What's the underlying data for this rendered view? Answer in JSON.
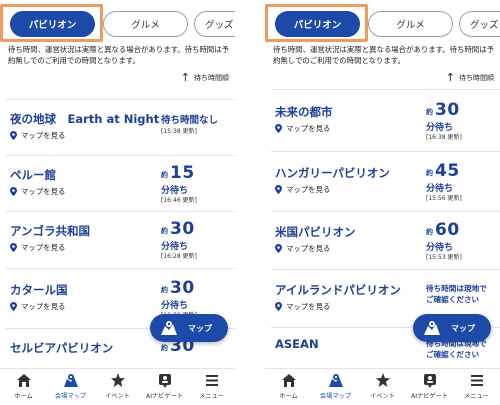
{
  "colors": {
    "primary": "#1d4aa8",
    "highlight": "#ef9a5f",
    "text": "#1d3f99"
  },
  "panels": [
    {
      "tabs": [
        {
          "label": "パビリオン",
          "active": true
        },
        {
          "label": "グルメ",
          "active": false
        },
        {
          "label": "グッズ",
          "active": false
        }
      ],
      "notice": "待ち時間、運営状況は実際と異なる場合があります。待ち時間は予約無しでのご利用での時間となります。",
      "sort_label": "待ち時間順",
      "items": [
        {
          "name": "夜の地球　Earth at Night",
          "map_label": "マップを見る",
          "wait_none": "待ち時間なし",
          "updated": "[15:38 更新]"
        },
        {
          "name": "ペルー館",
          "map_label": "マップを見る",
          "wait_pre": "約",
          "wait_num": "15",
          "wait_unit": "分待ち",
          "updated": "[16:46 更新]"
        },
        {
          "name": "アンゴラ共和国",
          "map_label": "マップを見る",
          "wait_pre": "約",
          "wait_num": "30",
          "wait_unit": "分待ち",
          "updated": "[16:28 更新]"
        },
        {
          "name": "カタール国",
          "map_label": "マップを見る",
          "wait_pre": "約",
          "wait_num": "30",
          "wait_unit": "分待ち",
          "updated": "[16:39 更新]"
        },
        {
          "name": "セルビアパビリオン",
          "map_label": "",
          "wait_pre": "約",
          "wait_num": "30",
          "wait_unit": "",
          "updated": ""
        }
      ],
      "fab_label": "マップ"
    },
    {
      "tabs": [
        {
          "label": "パビリオン",
          "active": true
        },
        {
          "label": "グルメ",
          "active": false
        },
        {
          "label": "グッズ",
          "active": false
        }
      ],
      "notice": "待ち時間、運営状況は実際と異なる場合があります。待ち時間は予約無しでのご利用での時間となります。",
      "sort_label": "待ち時間順",
      "items": [
        {
          "name": "未来の都市",
          "map_label": "マップを見る",
          "wait_pre": "約",
          "wait_num": "30",
          "wait_unit": "分待ち",
          "updated": "[16:38 更新]"
        },
        {
          "name": "ハンガリーパビリオン",
          "map_label": "マップを見る",
          "wait_pre": "約",
          "wait_num": "45",
          "wait_unit": "分待ち",
          "updated": "[15:56 更新]"
        },
        {
          "name": "米国パビリオン",
          "map_label": "マップを見る",
          "wait_pre": "約",
          "wait_num": "60",
          "wait_unit": "分待ち",
          "updated": "[15:53 更新]"
        },
        {
          "name": "アイルランドパビリオン",
          "map_label": "マップを見る",
          "wait_none": "待ち時間は現地でご確認ください"
        },
        {
          "name": "ASEAN",
          "map_label": "",
          "wait_none": "待ち時間は現地でご確認ください"
        }
      ],
      "fab_label": "マップ"
    }
  ],
  "bottom_nav": [
    {
      "label": "ホーム",
      "icon": "home-icon",
      "active": false
    },
    {
      "label": "会場マップ",
      "icon": "map-icon",
      "active": true
    },
    {
      "label": "イベント",
      "icon": "event-icon",
      "active": false
    },
    {
      "label": "AIナビゲート",
      "icon": "ai-navigate-icon",
      "active": false
    },
    {
      "label": "メニュー",
      "icon": "menu-icon",
      "active": false
    }
  ]
}
